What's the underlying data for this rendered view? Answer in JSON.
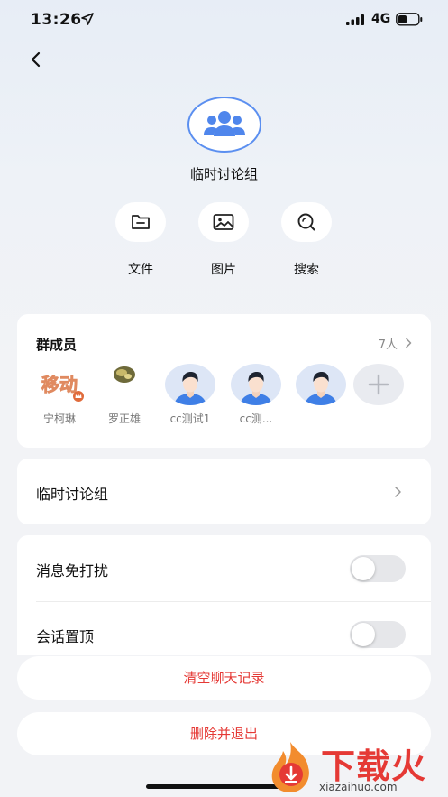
{
  "status_bar": {
    "time": "13:26",
    "network": "4G"
  },
  "group": {
    "name": "临时讨论组"
  },
  "actions": [
    {
      "label": "文件",
      "icon": "folder-icon"
    },
    {
      "label": "图片",
      "icon": "image-icon"
    },
    {
      "label": "搜索",
      "icon": "search-icon"
    }
  ],
  "members": {
    "title": "群成员",
    "count": "7人",
    "list": [
      {
        "name": "宁柯琳",
        "avatar": "avatar-image"
      },
      {
        "name": "罗正雄",
        "avatar": "avatar-image"
      },
      {
        "name": "cc测试1",
        "avatar": "person-avatar"
      },
      {
        "name": "cc测...",
        "avatar": "person-avatar"
      },
      {
        "name": "",
        "avatar": "person-avatar"
      }
    ]
  },
  "group_row": {
    "label": "临时讨论组"
  },
  "settings": [
    {
      "label": "消息免打扰",
      "on": false
    },
    {
      "label": "会话置顶",
      "on": false
    }
  ],
  "buttons": {
    "clear_history": "清空聊天记录",
    "delete_exit": "删除并退出"
  },
  "avatar_texts": {
    "member1_badge": "移动"
  },
  "watermark": {
    "text": "下载火",
    "site": "xiazaihuo.com"
  },
  "colors": {
    "accent": "#5b8ff0",
    "danger": "#e53935",
    "background": "#f2f3f6"
  }
}
